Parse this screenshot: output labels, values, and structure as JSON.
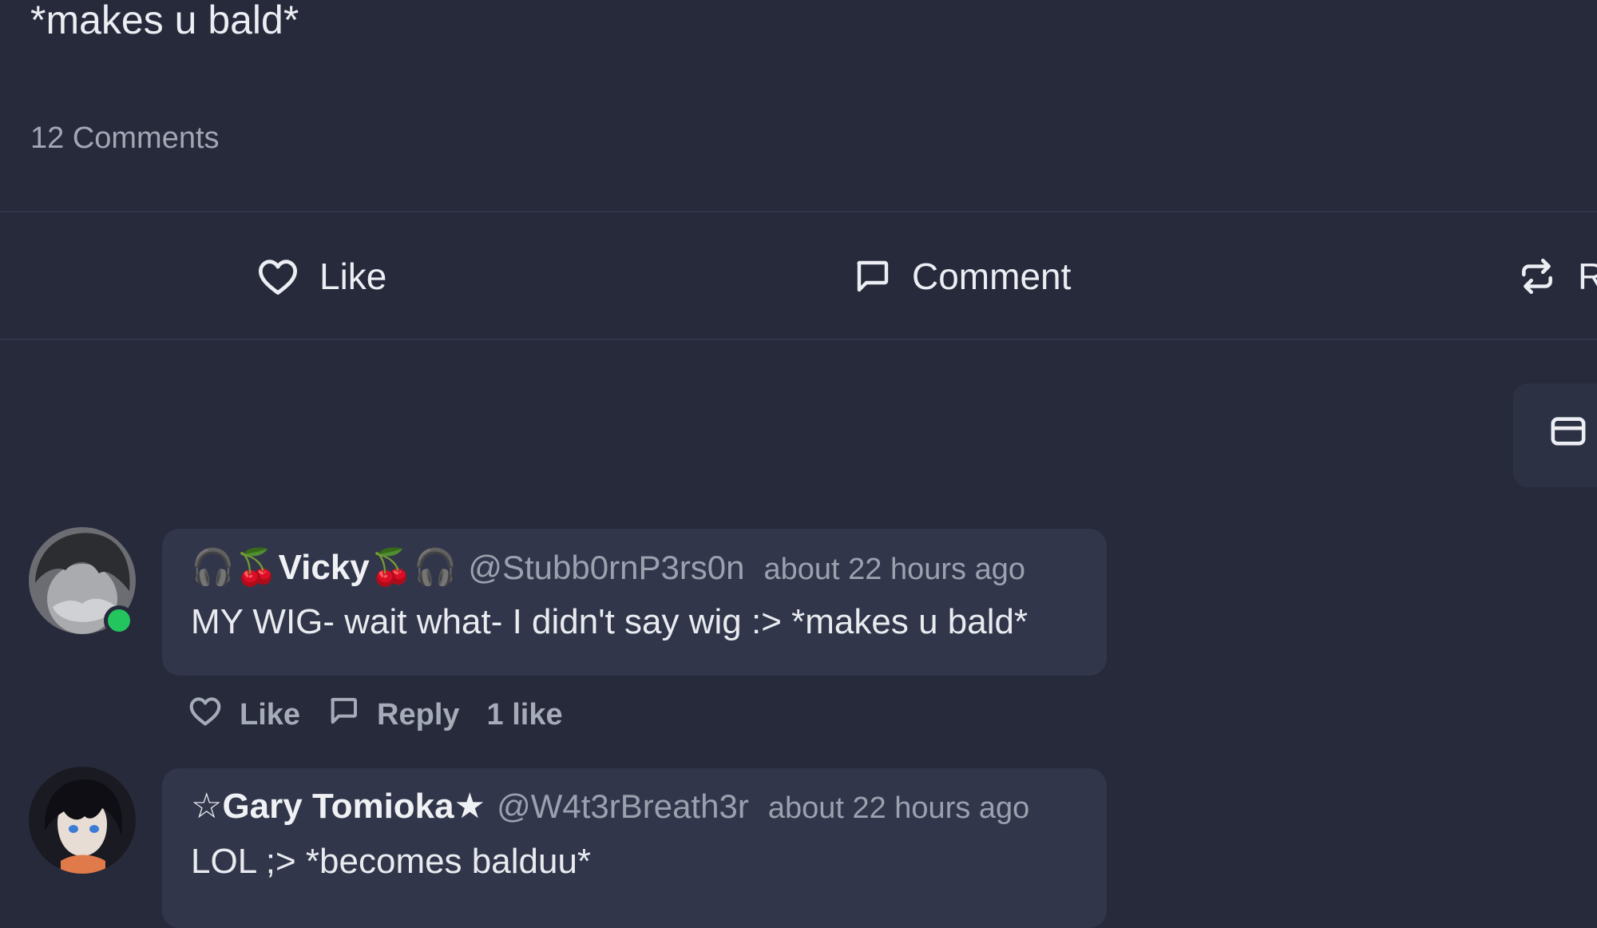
{
  "post": {
    "text": "*makes u bald*",
    "comments_count": "12 Comments"
  },
  "actions": {
    "like_label": "Like",
    "comment_label": "Comment",
    "repost_label": "R"
  },
  "comments": [
    {
      "author": "🎧🍒Vicky🍒🎧",
      "handle": "@Stubb0rnP3rs0n",
      "time": "about 22 hours ago",
      "body": "MY WIG- wait what- I didn't say wig :> *makes u bald*",
      "like_label": "Like",
      "reply_label": "Reply",
      "likes": "1 like",
      "online": true
    },
    {
      "author": "☆Gary Tomioka★",
      "handle": "@W4t3rBreath3r",
      "time": "about 22 hours ago",
      "body": "LOL ;> *becomes balduu*"
    }
  ],
  "colors": {
    "background": "#262a3b",
    "bubble": "#31364a",
    "online": "#22c55e",
    "muted_text": "#9ca1af"
  },
  "icons": [
    "heart-icon",
    "comment-bubble-icon",
    "repost-icon",
    "card-icon",
    "avatar"
  ]
}
